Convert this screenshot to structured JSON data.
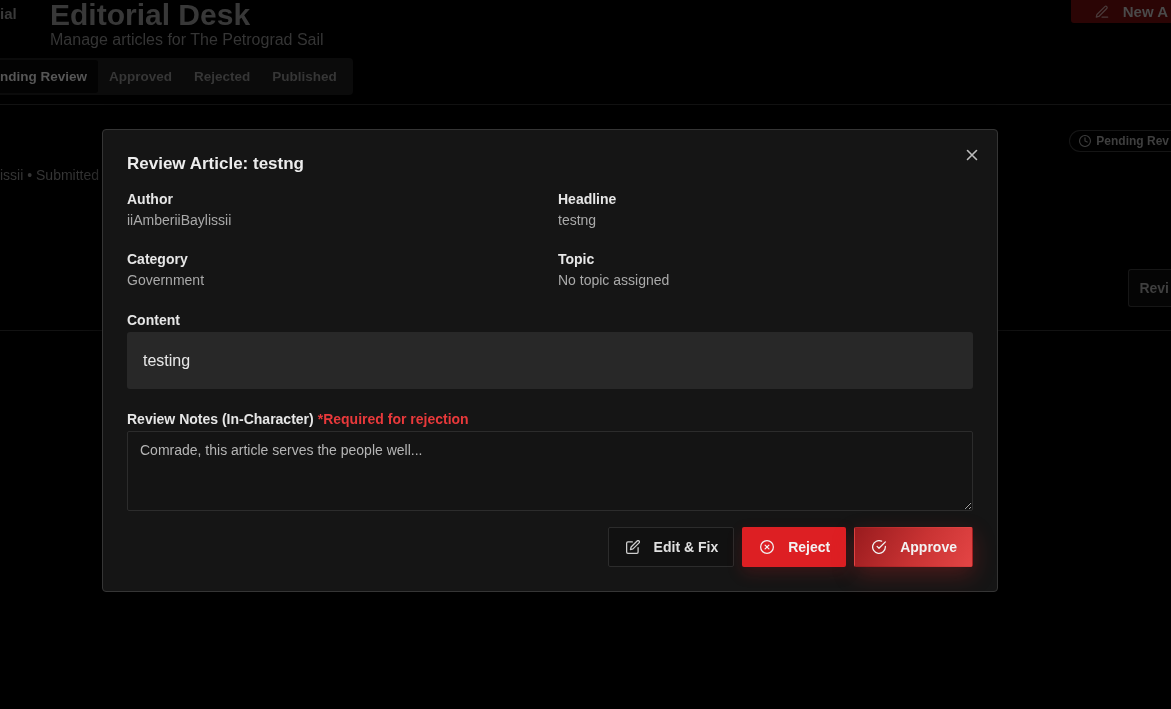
{
  "sidebar": {
    "brand_fragment": "ial"
  },
  "header": {
    "title": "Editorial Desk",
    "subtitle": "Manage articles for The Petrograd Sail",
    "new_button": "New A"
  },
  "tabs": [
    {
      "label": "nding Review",
      "selected": true
    },
    {
      "label": "Approved",
      "selected": false
    },
    {
      "label": "Rejected",
      "selected": false
    },
    {
      "label": "Published",
      "selected": false
    }
  ],
  "article_card": {
    "meta": "issii • Submitted",
    "status": "Pending Rev",
    "review_button": "Revi"
  },
  "dialog": {
    "title": "Review Article: testng",
    "fields": [
      {
        "label": "Author",
        "value": "iiAmberiiBaylissii"
      },
      {
        "label": "Headline",
        "value": "testng"
      },
      {
        "label": "Category",
        "value": "Government"
      },
      {
        "label": "Topic",
        "value": "No topic assigned"
      }
    ],
    "content": {
      "label": "Content",
      "value": "testing"
    },
    "review_notes": {
      "label": "Review Notes (In-Character)",
      "required_note": "*Required for rejection",
      "placeholder": "Comrade, this article serves the people well..."
    },
    "buttons": [
      {
        "kind": "outline",
        "label": "Edit & Fix"
      },
      {
        "kind": "danger",
        "label": "Reject"
      },
      {
        "kind": "primary",
        "label": "Approve"
      }
    ]
  }
}
